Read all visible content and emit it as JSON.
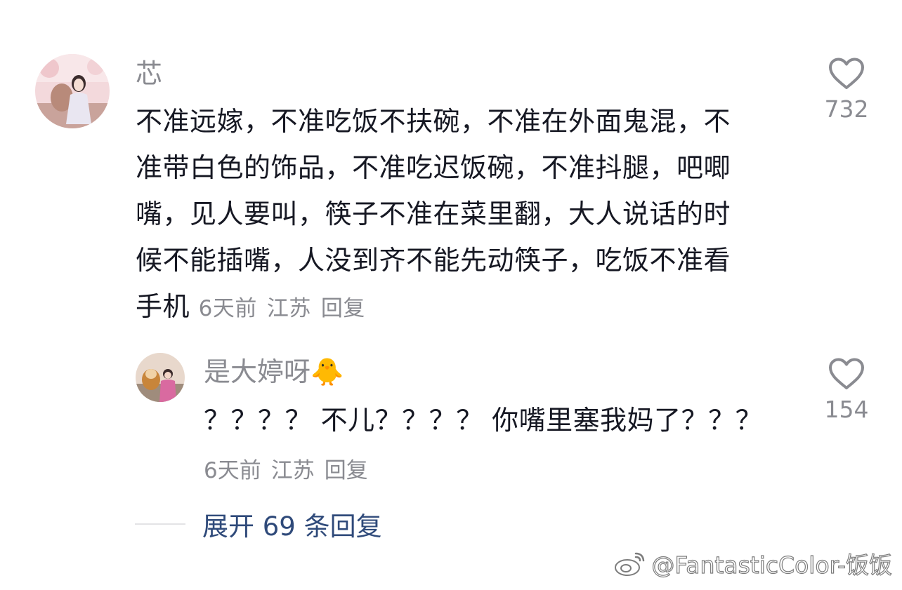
{
  "comment": {
    "username": "芯",
    "text_lines": [
      "不准远嫁，不准吃饭不扶碗，不准在外面鬼混，不",
      "准带白色的饰品，不准吃迟饭碗，不准抖腿，吧唧",
      "嘴，见人要叫，筷子不准在菜里翻，大人说话的时",
      "候不能插嘴，人没到齐不能先动筷子，吃饭不准看",
      "手机"
    ],
    "time": "6天前",
    "location": "江苏",
    "reply_label": "回复",
    "like_icon": "heart-outline-icon",
    "like_count": "732"
  },
  "reply": {
    "username": "是大婷呀",
    "username_emoji": "🐥",
    "text": "？？？？ 不儿？？？？ 你嘴里塞我妈了？？？",
    "time": "6天前",
    "location": "江苏",
    "reply_label": "回复",
    "like_icon": "heart-outline-icon",
    "like_count": "154"
  },
  "expand": {
    "label": "展开 69 条回复"
  },
  "watermark": {
    "icon": "weibo-logo-icon",
    "text": "@FantasticColor-饭饭"
  },
  "colors": {
    "text": "#161823",
    "secondary": "#8a8b91",
    "link": "#2f4a7a"
  }
}
